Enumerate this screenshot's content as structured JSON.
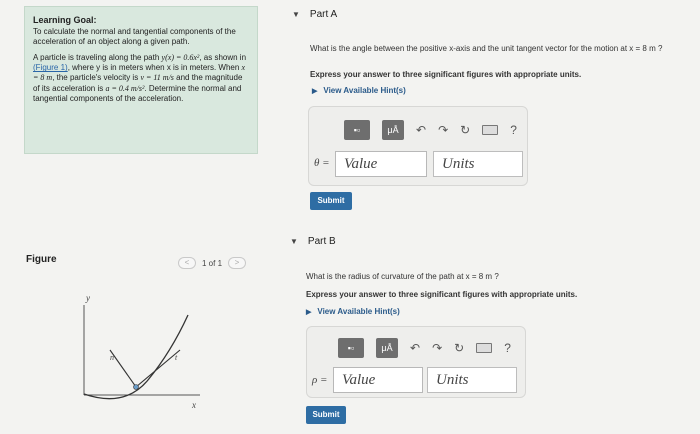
{
  "goal": {
    "title": "Learning Goal:",
    "text": "To calculate the normal and tangential components of the acceleration of an object along a given path.",
    "problem_1": "A particle is traveling along the path",
    "path_eq": "y(x) = 0.6x²",
    "problem_2": ", as shown in",
    "figure_link": "(Figure 1)",
    "problem_3": ", where y is in meters when x is in meters. When",
    "x_eq": "x = 8 m",
    "problem_4": ", the particle's velocity is",
    "v_eq": "v = 11 m/s",
    "problem_5": "and the magnitude of its acceleration is",
    "a_eq": "a = 0.4 m/s²",
    "problem_6": ". Determine the normal and tangential components of the acceleration."
  },
  "figure": {
    "label": "Figure",
    "pager_text": "1 of 1",
    "prev_symbol": "<",
    "next_symbol": ">",
    "axis_y": "y",
    "axis_x": "x",
    "label_n": "n",
    "label_t": "t"
  },
  "partA": {
    "header": "Part A",
    "triangle": "▼",
    "question": "What is the angle between the positive x-axis and the unit tangent vector for the motion at x = 8 m ?",
    "instruction": "Express your answer to three significant figures with appropriate units.",
    "hints_arrow": "▶",
    "hints": "View Available Hint(s)",
    "symbol": "θ =",
    "value_placeholder": "Value",
    "units_placeholder": "Units",
    "submit": "Submit"
  },
  "partB": {
    "header": "Part B",
    "triangle": "▼",
    "question": "What is the radius of curvature of the path at x = 8 m ?",
    "instruction": "Express your answer to three significant figures with appropriate units.",
    "hints_arrow": "▶",
    "hints": "View Available Hint(s)",
    "symbol": "ρ =",
    "value_placeholder": "Value",
    "units_placeholder": "Units",
    "submit": "Submit"
  },
  "toolbar": {
    "templates_icon": "▪▫",
    "units_button": "μÅ",
    "undo_icon": "↶",
    "redo_icon": "↷",
    "reset_icon": "↻",
    "help_icon": "?"
  }
}
